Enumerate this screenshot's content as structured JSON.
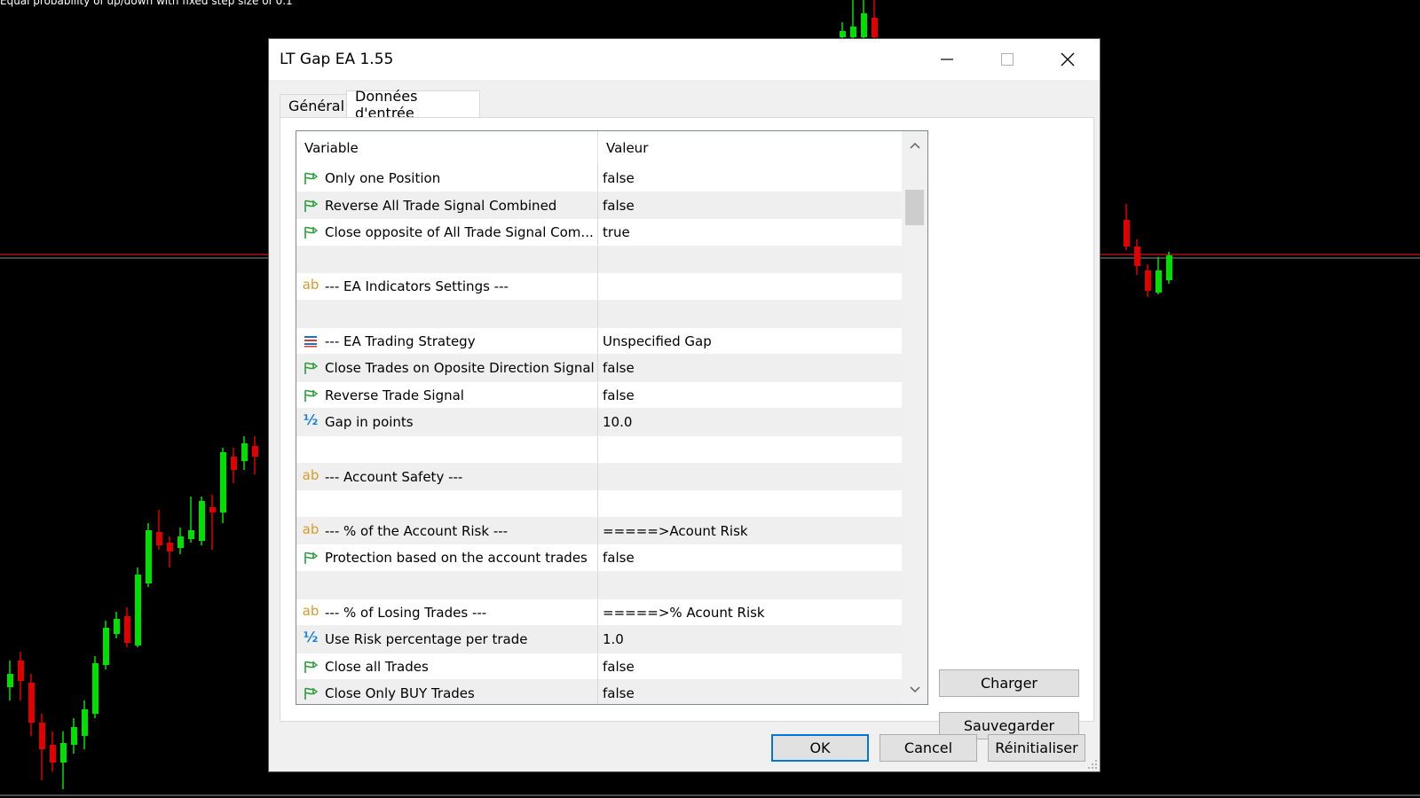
{
  "chart": {
    "caption": "Equal probability of up/down with fixed step size of 0.1",
    "up_color": "#00e000",
    "down_color": "#e00000",
    "price_line_color": "#ff1a1a"
  },
  "dialog": {
    "title": "LT Gap EA 1.55",
    "controls": {
      "minimize": "minimize-icon",
      "maximize": "maximize-icon",
      "close": "close-icon"
    },
    "tabs": [
      {
        "label": "Général",
        "active": false
      },
      {
        "label": "Données d'entrée",
        "active": true
      }
    ],
    "grid": {
      "columns": {
        "variable": "Variable",
        "value": "Valeur"
      },
      "rows": [
        {
          "icon": "bool",
          "variable": "Only one Position",
          "value": "false"
        },
        {
          "icon": "bool",
          "variable": "Reverse All Trade Signal Combined",
          "value": "false"
        },
        {
          "icon": "bool",
          "variable": "Close opposite of All Trade Signal Com...",
          "value": "true"
        },
        {
          "icon": "none",
          "variable": "",
          "value": ""
        },
        {
          "icon": "string",
          "variable": "--- EA Indicators Settings ---",
          "value": ""
        },
        {
          "icon": "none",
          "variable": "",
          "value": ""
        },
        {
          "icon": "enum",
          "variable": "--- EA Trading Strategy",
          "value": "Unspecified Gap"
        },
        {
          "icon": "bool",
          "variable": "Close Trades on Oposite Direction Signal",
          "value": "false"
        },
        {
          "icon": "bool",
          "variable": "Reverse Trade Signal",
          "value": "false"
        },
        {
          "icon": "double",
          "variable": "Gap in points",
          "value": "10.0"
        },
        {
          "icon": "none",
          "variable": "",
          "value": ""
        },
        {
          "icon": "string",
          "variable": "--- Account Safety ---",
          "value": ""
        },
        {
          "icon": "none",
          "variable": "",
          "value": ""
        },
        {
          "icon": "string",
          "variable": "--- % of the Account Risk ---",
          "value": "=====>Acount Risk"
        },
        {
          "icon": "bool",
          "variable": "Protection based on the account trades",
          "value": "false"
        },
        {
          "icon": "none",
          "variable": "",
          "value": ""
        },
        {
          "icon": "string",
          "variable": "--- % of Losing Trades ---",
          "value": "=====>% Acount Risk"
        },
        {
          "icon": "double",
          "variable": "Use Risk percentage per trade",
          "value": "1.0"
        },
        {
          "icon": "bool",
          "variable": "Close all Trades",
          "value": "false"
        },
        {
          "icon": "bool",
          "variable": "Close Only BUY Trades",
          "value": "false"
        }
      ]
    },
    "buttons": {
      "load": "Charger",
      "save": "Sauvegarder",
      "ok": "OK",
      "cancel": "Cancel",
      "reset": "Réinitialiser"
    }
  }
}
